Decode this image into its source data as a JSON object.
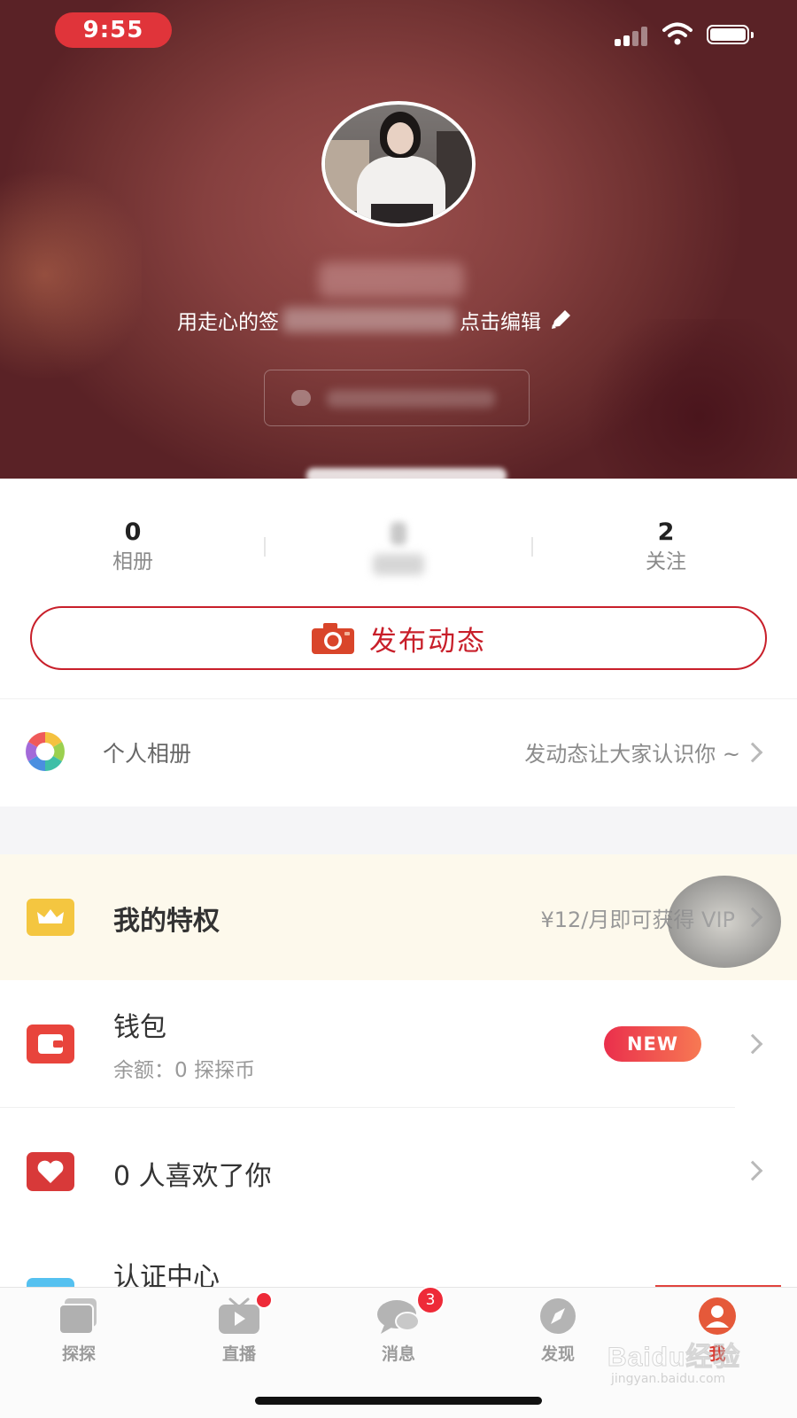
{
  "status_bar": {
    "time": "9:55"
  },
  "profile": {
    "signature_prefix": "用走心的签",
    "signature_suffix": "点击编辑"
  },
  "stats": [
    {
      "value": "0",
      "label": "相册"
    },
    {
      "value": "",
      "label": ""
    },
    {
      "value": "2",
      "label": "关注"
    }
  ],
  "publish_button": {
    "label": "发布动态"
  },
  "album_row": {
    "label": "个人相册",
    "hint": "发动态让大家认识你 ~"
  },
  "vip_row": {
    "title": "我的特权",
    "hint": "¥12/月即可获得 VIP"
  },
  "wallet_row": {
    "title": "钱包",
    "subtitle": "余额：0 探探币",
    "badge": "NEW"
  },
  "likes_row": {
    "title": "0 人喜欢了你"
  },
  "cert_row": {
    "title": "认证中心"
  },
  "tabbar": {
    "tabs": [
      {
        "label": "探探",
        "icon": "cards-icon"
      },
      {
        "label": "直播",
        "icon": "live-tv-icon",
        "has_dot": true
      },
      {
        "label": "消息",
        "icon": "chat-bubble-icon",
        "badge": "3"
      },
      {
        "label": "发现",
        "icon": "compass-icon"
      },
      {
        "label": "我",
        "icon": "profile-icon",
        "active": true
      }
    ]
  },
  "watermark": {
    "brand": "Baidu经验",
    "url": "jingyan.baidu.com"
  },
  "colors": {
    "accent": "#c81f2a",
    "badge_red": "#ee2a38",
    "vip_bg": "#fdf9ec",
    "vip_icon": "#f4c640",
    "wallet_icon": "#e8443c"
  }
}
